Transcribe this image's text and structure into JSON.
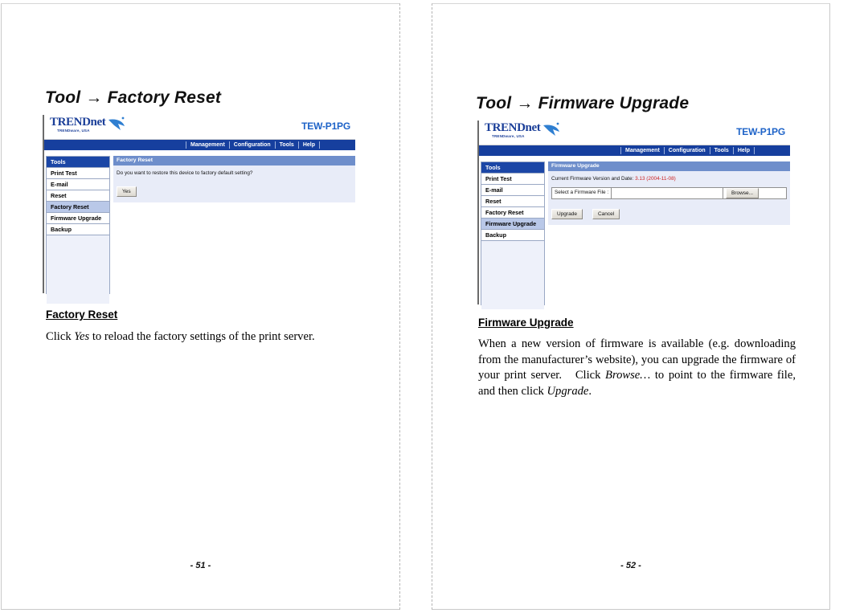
{
  "document": {
    "left_page": {
      "chapter_title": "Tool → Factory Reset",
      "section_heading": "Factory Reset",
      "body_text_before": "Click ",
      "body_text_italic": "Yes",
      "body_text_after": " to reload the factory settings of the print server.",
      "folio": "- 51 -"
    },
    "right_page": {
      "chapter_title": "Tool → Firmware Upgrade",
      "section_heading": "Firmware Upgrade",
      "body_text_1": "When a new version of firmware is available (e.g. downloading from the manufacturer’s website), you can upgrade the firmware of your print server.   Click ",
      "body_italic_1": "Browse…",
      "body_text_2": " to point to the firmware file, and then click ",
      "body_italic_2": "Upgrade",
      "body_text_3": ".",
      "folio": "- 52 -"
    }
  },
  "device_ui": {
    "brand": "TRENDnet",
    "brand_sub": "TRENDware, USA",
    "model": "TEW-P1PG",
    "nav": [
      {
        "label": "Management"
      },
      {
        "label": "Configuration"
      },
      {
        "label": "Tools"
      },
      {
        "label": "Help"
      }
    ],
    "sidebar": [
      {
        "label": "Tools",
        "state": "header"
      },
      {
        "label": "Print Test",
        "state": "normal"
      },
      {
        "label": "E-mail",
        "state": "normal"
      },
      {
        "label": "Reset",
        "state": "normal"
      },
      {
        "label": "Factory Reset",
        "state": "normal"
      },
      {
        "label": "Firmware Upgrade",
        "state": "normal"
      },
      {
        "label": "Backup",
        "state": "normal"
      }
    ],
    "factory_reset_panel": {
      "title": "Factory Reset",
      "question": "Do you want to restore this device to factory default setting?",
      "yes_button": "Yes"
    },
    "firmware_panel": {
      "title": "Firmware Upgrade",
      "version_label": "Current Firmware Version and Date: ",
      "version_value": "3.13 (2004-11-08)",
      "file_label": "Select a Firmware File :",
      "file_value": "",
      "browse_button": "Browse...",
      "upgrade_button": "Upgrade",
      "cancel_button": "Cancel"
    },
    "colors": {
      "nav_blue": "#163f9e",
      "panel_title_blue": "#6e8ecb",
      "panel_bg": "#e8ecf8",
      "sidebar_selected": "#b9c8e8",
      "sidebar_header": "#1b46a6",
      "model_blue": "#1e63c8",
      "version_red": "#cc2222"
    }
  }
}
